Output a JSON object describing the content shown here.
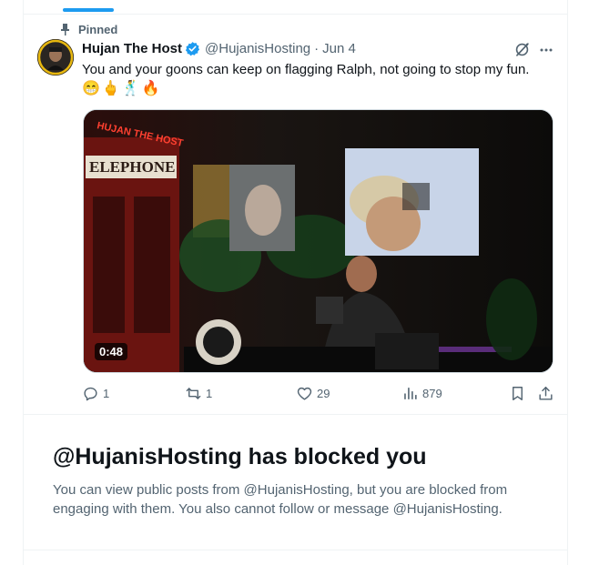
{
  "pinned_label": "Pinned",
  "post": {
    "display_name": "Hujan The Host",
    "handle": "@HujanisHosting",
    "separator": "·",
    "date": "Jun 4",
    "text": "You and your goons can keep on flagging Ralph, not going to stop my fun.",
    "emojis": [
      "😁",
      "🖕",
      "🕺",
      "🔥"
    ],
    "video": {
      "duration": "0:48",
      "sign_text": "HUJAN THE HOST",
      "booth_text": "ELEPHONE"
    },
    "stats": {
      "replies": "1",
      "reposts": "1",
      "likes": "29",
      "views": "879"
    }
  },
  "blocked": {
    "title": "@HujanisHosting has blocked you",
    "description": "You can view public posts from @HujanisHosting, but you are blocked from engaging with them. You also cannot follow or message @HujanisHosting."
  },
  "colors": {
    "accent": "#1d9bf0",
    "secondary_text": "#536471",
    "primary_text": "#0f1419",
    "divider": "#eff3f4"
  },
  "icons": [
    "pin-icon",
    "verified-badge-icon",
    "grok-icon",
    "more-icon",
    "reply-icon",
    "repost-icon",
    "like-icon",
    "views-icon",
    "bookmark-icon",
    "share-icon"
  ]
}
